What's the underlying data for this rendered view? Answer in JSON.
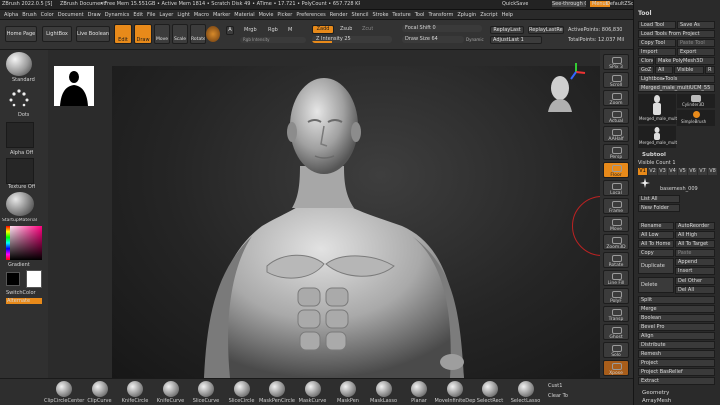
{
  "titlebar": {
    "app": "ZBrush 2022.0.5 [S]",
    "doc": "ZBrush Document",
    "stats": "• Free Mem 15.551GB • Active Mem 1814 • Scratch Disk 49 • ATime • 17.721 • PolyCount • 657.728 KP • MeshCount • 2",
    "quicksave": "QuickSave",
    "seethrough": "See-through 0",
    "menus": "Menus",
    "zscript": "DefaultZScript"
  },
  "menubar": [
    "Alpha",
    "Brush",
    "Color",
    "Document",
    "Draw",
    "Dynamics",
    "Edit",
    "File",
    "Layer",
    "Light",
    "Macro",
    "Marker",
    "Material",
    "Movie",
    "Picker",
    "Preferences",
    "Render",
    "Stencil",
    "Stroke",
    "Texture",
    "Tool",
    "Transform",
    "Zplugin",
    "Zscript",
    "Help"
  ],
  "toolbar": {
    "home": "Home Page",
    "lightbox": "LightBox",
    "livebool": "Live Boolean",
    "edit": "Edit",
    "draw": "Draw",
    "move": "Move",
    "scale": "Scale",
    "rotate": "Rotate",
    "a": "A",
    "mrgb": "Mrgb",
    "rgb": "Rgb",
    "m": "M",
    "rgb_intensity": "Rgb Intensity",
    "zadd": "Zadd",
    "zsub": "Zsub",
    "zcut": "Zcut",
    "z_intensity": "Z Intensity 25",
    "z_intensity_level": 0.25,
    "focal_shift": "Focal Shift 0",
    "focal_shift_level": 0.5,
    "draw_size": "Draw Size 64",
    "draw_size_level": 0.5,
    "dynamic": "Dynamic",
    "replay_last": "ReplayLast",
    "replay_last_rel": "ReplayLastRel",
    "adjust_last": "AdjustLast 1",
    "active_points": "ActivePoints: 806,830",
    "total_points": "TotalPoints: 12.037 Mil"
  },
  "left_shelf": {
    "brush": "Standard",
    "stroke": "Dots",
    "alpha": "Alpha Off",
    "texture": "Texture Off",
    "material": "StartupMaterial",
    "gradient": "Gradient",
    "switch_color": "SwitchColor",
    "alternate": "Alternate"
  },
  "right_shelf": [
    "SPix 3",
    "Scroll",
    "Zoom",
    "Actual",
    "AAHalf",
    "Persp",
    "Floor",
    "Local",
    "Frame",
    "Move",
    "Zoom3D",
    "Rotate",
    "Line Fill",
    "PolyF",
    "Transp",
    "Ghost",
    "Solo",
    "Xpose"
  ],
  "tool_panel": {
    "title": "Tool",
    "load_tool": "Load Tool",
    "save_as": "Save As",
    "load_from_project": "Load Tools From Project",
    "copy_tool": "Copy Tool",
    "paste_tool": "Paste Tool",
    "import": "Import",
    "export": "Export",
    "clone": "Clone",
    "make_polymesh": "Make PolyMesh3D",
    "goz": "GoZ",
    "all": "All",
    "visible": "Visible",
    "r": "R",
    "lightbox_tools": "Lightbox▸Tools",
    "current_tool": "Merged_male_multiUCM_55",
    "thumb1": "Merged_male_mult",
    "thumb2": "Cylinder3D",
    "thumb3": "SimpleBrush",
    "thumb4": "Merged_male_mult",
    "subtool_title": "Subtool",
    "visible_count": "Visible Count 1",
    "subtools": [
      "V1",
      "V2",
      "V3",
      "V4",
      "V5",
      "V6",
      "V7",
      "V8"
    ],
    "basemesh": "basemesh_009",
    "list_all": "List All",
    "new_folder": "New Folder",
    "rename": "Rename",
    "autoreorder": "AutoReorder",
    "all_low": "All Low",
    "all_high": "All High",
    "all_to_home": "All To Home",
    "all_to_target": "All To Target",
    "copy": "Copy",
    "paste": "Paste",
    "duplicate": "Duplicate",
    "append": "Append",
    "insert": "Insert",
    "delete": "Delete",
    "del_other": "Del Other",
    "del_all": "Del All",
    "split": "Split",
    "merge": "Merge",
    "boolean": "Boolean",
    "bevel_pro": "Bevel Pro",
    "align": "Align",
    "distribute": "Distribute",
    "remesh": "Remesh",
    "project": "Project",
    "project_basrelief": "Project BasRelief",
    "extract": "Extract",
    "geometry": "Geometry",
    "arraymesh": "ArrayMesh"
  },
  "bottom_bar": [
    "ClipCircleCenter",
    "ClipCurve",
    "KnifeCircle",
    "KnifeCurve",
    "SliceCurve",
    "SliceCircle",
    "MaskPenCircle",
    "MaskCurve",
    "MaskPen",
    "MaskLasso",
    "Planar",
    "MoveInfiniteDep",
    "SelectRect",
    "SelectLasso"
  ],
  "bottom_right": {
    "curve": "Cust1",
    "clear": "Clear To"
  },
  "colors": {
    "accent": "#e88a1a",
    "bg": "#2b2b2b"
  }
}
